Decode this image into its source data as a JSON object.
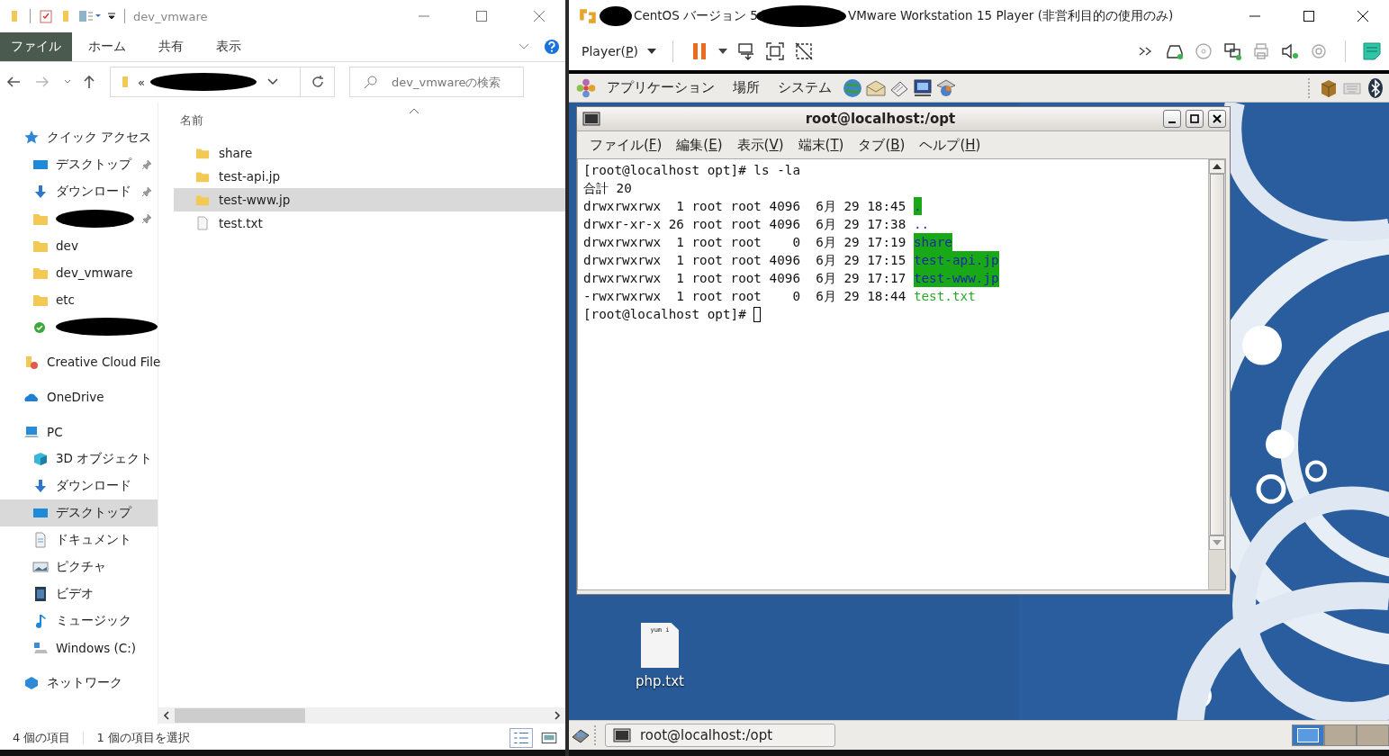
{
  "explorer": {
    "title": "dev_vmware",
    "ribbon_tabs": [
      {
        "label": "ファイル",
        "selected": true
      },
      {
        "label": "ホーム",
        "selected": false
      },
      {
        "label": "共有",
        "selected": false
      },
      {
        "label": "表示",
        "selected": false
      }
    ],
    "address": {
      "prefix": "«",
      "redacted": true
    },
    "search": {
      "placeholder": "dev_vmwareの検索"
    },
    "nav": [
      {
        "label": "クイック アクセス",
        "kind": "star",
        "selected": false,
        "children": [
          {
            "label": "デスクトップ",
            "kind": "desktop",
            "pinned": true,
            "redacted": false,
            "selected": false
          },
          {
            "label": "ダウンロード",
            "kind": "download",
            "pinned": true,
            "redacted": false,
            "selected": false
          },
          {
            "kind": "folder",
            "pinned": true,
            "redacted": true,
            "selected": false
          },
          {
            "label": "dev",
            "kind": "folder",
            "pinned": false,
            "redacted": false,
            "selected": false
          },
          {
            "label": "dev_vmware",
            "kind": "folder",
            "pinned": false,
            "redacted": false,
            "selected": false
          },
          {
            "label": "etc",
            "kind": "folder",
            "pinned": false,
            "redacted": false,
            "selected": false
          },
          {
            "kind": "synced",
            "pinned": false,
            "redacted": true,
            "selected": false
          }
        ]
      },
      {
        "label": "Creative Cloud File",
        "kind": "cloud-files",
        "selected": false
      },
      {
        "label": "OneDrive",
        "kind": "onedrive",
        "selected": false
      },
      {
        "label": "PC",
        "kind": "pc",
        "selected": false,
        "children": [
          {
            "label": "3D オブジェクト",
            "kind": "cube",
            "selected": false
          },
          {
            "label": "ダウンロード",
            "kind": "download",
            "selected": false
          },
          {
            "label": "デスクトップ",
            "kind": "desktop",
            "selected": true
          },
          {
            "label": "ドキュメント",
            "kind": "document",
            "selected": false
          },
          {
            "label": "ピクチャ",
            "kind": "pictures",
            "selected": false
          },
          {
            "label": "ビデオ",
            "kind": "video",
            "selected": false
          },
          {
            "label": "ミュージック",
            "kind": "music",
            "selected": false
          },
          {
            "label": "Windows (C:)",
            "kind": "drive",
            "selected": false
          }
        ]
      },
      {
        "label": "ネットワーク",
        "kind": "network",
        "selected": false
      }
    ],
    "column_header": "名前",
    "files": [
      {
        "name": "share",
        "kind": "folder",
        "selected": false
      },
      {
        "name": "test-api.jp",
        "kind": "folder",
        "selected": false
      },
      {
        "name": "test-www.jp",
        "kind": "folder",
        "selected": true
      },
      {
        "name": "test.txt",
        "kind": "text",
        "selected": false
      }
    ],
    "status": {
      "count": "4 個の項目",
      "selection": "1 個の項目を選択"
    }
  },
  "vmware": {
    "title_parts": [
      "CentOS バージョン 5",
      "VMware Workstation 15 Player (非営利目的の使用のみ)"
    ],
    "player_menu": {
      "before": "Player(",
      "key": "P",
      "after": ")"
    }
  },
  "gnome": {
    "panel_menus": [
      "アプリケーション",
      "場所",
      "システム"
    ],
    "terminal": {
      "title": "root@localhost:/opt",
      "menus": [
        {
          "before": "ファイル(",
          "key": "F",
          "after": ")"
        },
        {
          "before": "編集(",
          "key": "E",
          "after": ")"
        },
        {
          "before": "表示(",
          "key": "V",
          "after": ")"
        },
        {
          "before": "端末(",
          "key": "T",
          "after": ")"
        },
        {
          "before": "タブ(",
          "key": "B",
          "after": ")"
        },
        {
          "before": "ヘルプ(",
          "key": "H",
          "after": ")"
        }
      ],
      "lines": [
        {
          "text": "[root@localhost opt]# ls -la",
          "cursor": false
        },
        {
          "text": "合計 20",
          "cursor": false
        },
        {
          "text": "drwxrwxrwx  1 root root 4096  6月 29 18:45 ",
          "name": ".",
          "color": "#18a818",
          "highlighted": true,
          "cursor": false
        },
        {
          "text": "drwxr-xr-x 26 root root 4096  6月 29 17:38 ",
          "name": "..",
          "color": "#2030b0",
          "highlighted": false,
          "cursor": false
        },
        {
          "text": "drwxrwxrwx  1 root root    0  6月 29 17:19 ",
          "name": "share",
          "color": "#18a818",
          "highlighted": true,
          "cursor": false
        },
        {
          "text": "drwxrwxrwx  1 root root 4096  6月 29 17:15 ",
          "name": "test-api.jp",
          "color": "#18a818",
          "highlighted": true,
          "cursor": false
        },
        {
          "text": "drwxrwxrwx  1 root root 4096  6月 29 17:17 ",
          "name": "test-www.jp",
          "color": "#18a818",
          "highlighted": true,
          "cursor": false
        },
        {
          "text": "-rwxrwxrwx  1 root root    0  6月 29 18:44 ",
          "name": "test.txt",
          "color": "#2aa82a",
          "highlighted": false,
          "cursor": false
        },
        {
          "text": "[root@localhost opt]# ",
          "cursor": true
        }
      ]
    },
    "desktop_icons": [
      {
        "label": "php.txt",
        "preview": "yum i"
      }
    ],
    "taskbar": [
      {
        "label": "root@localhost:/opt",
        "selected": false
      }
    ]
  }
}
